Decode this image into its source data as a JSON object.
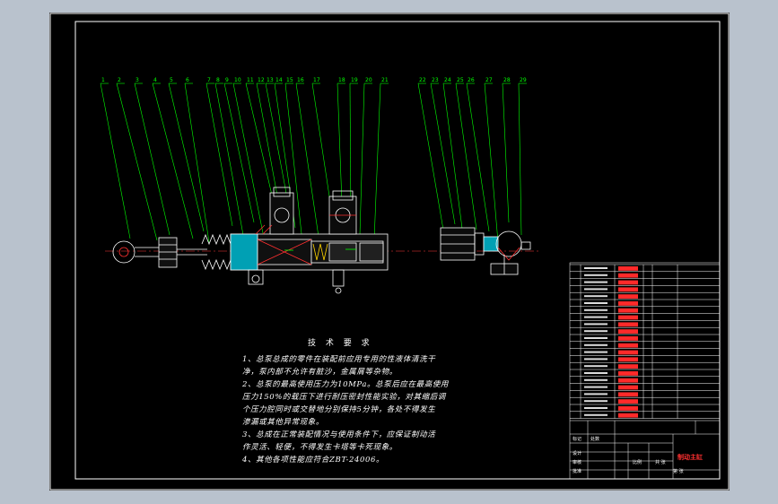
{
  "balloons": [
    "1",
    "2",
    "3",
    "4",
    "5",
    "6",
    "7",
    "8",
    "9",
    "10",
    "11",
    "12",
    "13",
    "14",
    "15",
    "16",
    "17",
    "18",
    "19",
    "20",
    "21",
    "22",
    "23",
    "24",
    "25",
    "26",
    "27",
    "28",
    "29"
  ],
  "tech_requirements": {
    "title": "技 术 要 求",
    "lines": [
      "1、总泵总成的零件在装配前应用专用的性液体清洗干",
      "净，泵内部不允许有脏沙，金属屑等杂物。",
      "2、总泵的最高使用压力为10MPa。总泵后应在最高使用",
      "压力150%的载压下进行耐压密封性能实验，对其缩后调",
      "个压力腔同时或交替地分别保持5分钟，各处不得发生",
      "渗漏或其他异常现象。",
      "3、总成在正常装配情况与使用条件下，应保证制动活",
      "作灵活、轻便，不得发生卡塔等卡死现象。",
      "4、其他各项性能应符合ZBT-24006。"
    ]
  },
  "title_block": {
    "drawing_title": "制动主缸",
    "cells": [
      "标记",
      "处数",
      "设计",
      "审核",
      "批准",
      "比例",
      "共 张",
      "第 张"
    ]
  },
  "colors": {
    "sheet": "#000000",
    "frame": "#ffffff",
    "leaders": "#00ff00",
    "part": "#ffffff",
    "accent_red": "#ff2a2a",
    "accent_cyan": "#00e5ff",
    "accent_yellow": "#ffd400"
  }
}
